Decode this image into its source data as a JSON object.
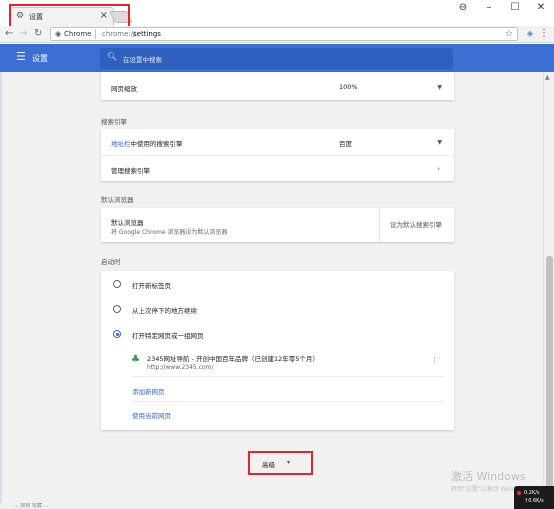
{
  "browser": {
    "tab_title": "设置",
    "tab_close": "×",
    "site_chip": "Chrome",
    "url_scheme": "chrome://",
    "url_host": "settings",
    "window_controls": [
      "⊖",
      "–",
      "☐",
      "✕"
    ]
  },
  "header": {
    "menu_icon": "☰",
    "title": "设置",
    "search_placeholder": "在设置中搜索"
  },
  "appearance": {
    "page_zoom_label": "网页缩放",
    "page_zoom_value": "100%"
  },
  "search_engine": {
    "section_title": "搜索引擎",
    "address_bar_link": "地址栏",
    "address_bar_rest": "中使用的搜索引擎",
    "engine_value": "百度",
    "manage_label": "管理搜索引擎"
  },
  "default_browser": {
    "section_title": "默认浏览器",
    "label": "默认浏览器",
    "sublabel": "将 Google Chrome 浏览器设为默认浏览器",
    "button": "设为默认搜索引擎"
  },
  "on_startup": {
    "section_title": "启动时",
    "options": [
      {
        "label": "打开新标签页",
        "selected": false
      },
      {
        "label": "从上次停下的地方继续",
        "selected": false
      },
      {
        "label": "打开特定网页或一组网页",
        "selected": true
      }
    ],
    "site_title": "2345网址导航 - 开创中国百年品牌（已创建12年零5个月）",
    "site_url": "http://www.2345.com/",
    "add_page": "添加新网页",
    "use_current": "使用当前网页"
  },
  "advanced": {
    "label": "高级",
    "caret": "▾"
  },
  "watermark": {
    "line1": "激活 Windows",
    "line2": "转到\"设置\"以激活 Windows。"
  },
  "tray": {
    "line1": "0.2K/s",
    "line2": "↑0.6K/s"
  },
  "bottom_strip": "   ...  搜狗  收藏  ..."
}
